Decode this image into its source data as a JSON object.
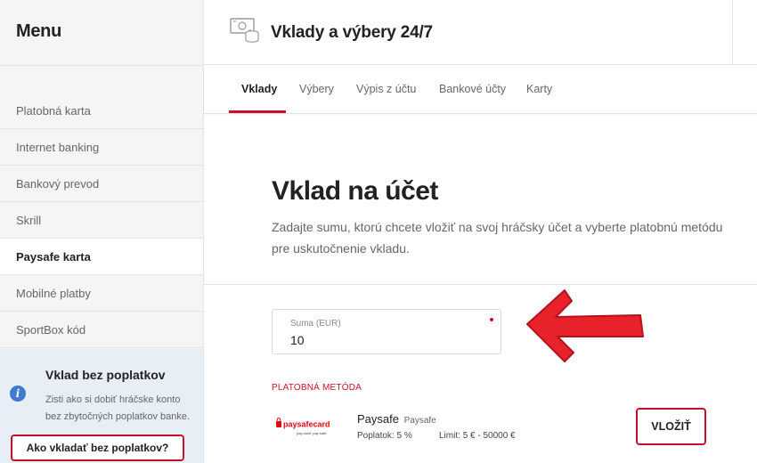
{
  "sidebar": {
    "title": "Menu",
    "items": [
      {
        "label": "Platobná karta",
        "active": false
      },
      {
        "label": "Internet banking",
        "active": false
      },
      {
        "label": "Bankový prevod",
        "active": false
      },
      {
        "label": "Skrill",
        "active": false
      },
      {
        "label": "Paysafe karta",
        "active": true
      },
      {
        "label": "Mobilné platby",
        "active": false
      },
      {
        "label": "SportBox kód",
        "active": false
      }
    ],
    "promo": {
      "icon": "info-icon",
      "title": "Vklad bez poplatkov",
      "text": "Zisti ako si dobiť hráčske konto bez zbytočných poplatkov banke.",
      "button_label": "Ako vkladať bez poplatkov?"
    }
  },
  "header": {
    "icon": "money-coins-icon",
    "title": "Vklady a výbery 24/7"
  },
  "tabs": [
    {
      "label": "Vklady",
      "active": true
    },
    {
      "label": "Výbery",
      "active": false
    },
    {
      "label": "Výpis z účtu",
      "active": false
    },
    {
      "label": "Bankové účty",
      "active": false
    },
    {
      "label": "Karty",
      "active": false
    }
  ],
  "main": {
    "title": "Vklad na účet",
    "description": "Zadajte sumu, ktorú chcete vložiť na svoj hráčsky účet a vyberte platobnú metódu pre uskutočnenie vkladu.",
    "amount": {
      "label": "Suma (EUR)",
      "value": "10"
    },
    "payment_method_label": "PLATOBNÁ METÓDA",
    "method": {
      "logo_text": "paysafecard",
      "logo_subtext": "pay cash. pay safe.",
      "name": "Paysafe",
      "provider": "Paysafe",
      "fee_label": "Poplatok:",
      "fee_value": "5 %",
      "limit_label": "Limit:",
      "limit_value": "5 € - 50000 €",
      "button_label": "VLOŽIŤ"
    }
  },
  "colors": {
    "accent": "#c8102e",
    "arrow": "#e8222b",
    "info": "#3d7ad0",
    "sidebar_bg": "#f5f5f5",
    "promo_bg": "#e8eef6"
  }
}
